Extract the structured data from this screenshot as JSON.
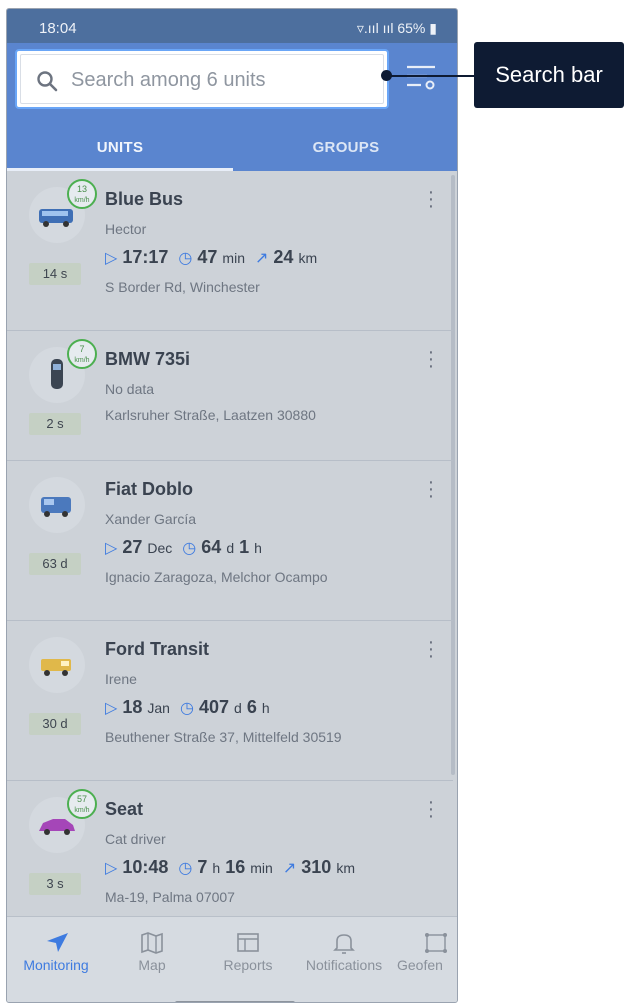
{
  "status_bar": {
    "time": "18:04",
    "signal": "▿.ııl ııl",
    "battery": "65%"
  },
  "search": {
    "placeholder": "Search among 6 units"
  },
  "tabs": [
    {
      "label": "UNITS"
    },
    {
      "label": "GROUPS"
    }
  ],
  "units": [
    {
      "name": "Blue Bus",
      "driver": "Hector",
      "speed": "13",
      "speed_unit": "km/h",
      "badge": "14 s",
      "time": "17:17",
      "time_unit": "",
      "duration_a": "47",
      "duration_a_unit": "min",
      "duration_b": "",
      "duration_b_unit": "",
      "distance": "24",
      "distance_unit": "km",
      "address": "S Border Rd, Winchester",
      "icon": "bus-icon"
    },
    {
      "name": "BMW 735i",
      "driver": "No data",
      "speed": "7",
      "speed_unit": "km/h",
      "badge": "2 s",
      "address": "Karlsruher Straße, Laatzen 30880",
      "icon": "car-top-icon"
    },
    {
      "name": "Fiat Doblo",
      "driver": "Xander García",
      "badge": "63 d",
      "time": "27",
      "time_unit": "Dec",
      "duration_a": "64",
      "duration_a_unit": "d",
      "duration_b": "1",
      "duration_b_unit": "h",
      "address": "Ignacio Zaragoza, Melchor Ocampo",
      "icon": "van-icon"
    },
    {
      "name": "Ford Transit",
      "driver": "Irene",
      "badge": "30 d",
      "time": "18",
      "time_unit": "Jan",
      "duration_a": "407",
      "duration_a_unit": "d",
      "duration_b": "6",
      "duration_b_unit": "h",
      "address": "Beuthener Straße 37, Mittelfeld 30519",
      "icon": "truck-icon"
    },
    {
      "name": "Seat",
      "driver": "Cat driver",
      "speed": "57",
      "speed_unit": "km/h",
      "badge": "3 s",
      "time": "10:48",
      "time_unit": "",
      "duration_a": "7",
      "duration_a_unit": "h",
      "duration_b": "16",
      "duration_b_unit": "min",
      "distance": "310",
      "distance_unit": "km",
      "address": "Ma-19, Palma 07007",
      "icon": "car-icon"
    }
  ],
  "nav": [
    {
      "label": "Monitoring",
      "icon": "navigation-arrow-icon"
    },
    {
      "label": "Map",
      "icon": "map-icon"
    },
    {
      "label": "Reports",
      "icon": "reports-icon"
    },
    {
      "label": "Notifications",
      "icon": "bell-icon"
    },
    {
      "label": "Geofen",
      "icon": "geofence-icon"
    }
  ],
  "callout": {
    "label": "Search bar"
  },
  "colors": {
    "accent": "#3e7be0",
    "header": "#5a85cf",
    "callout": "#0e1b33",
    "speed_ring": "#4caf50"
  }
}
